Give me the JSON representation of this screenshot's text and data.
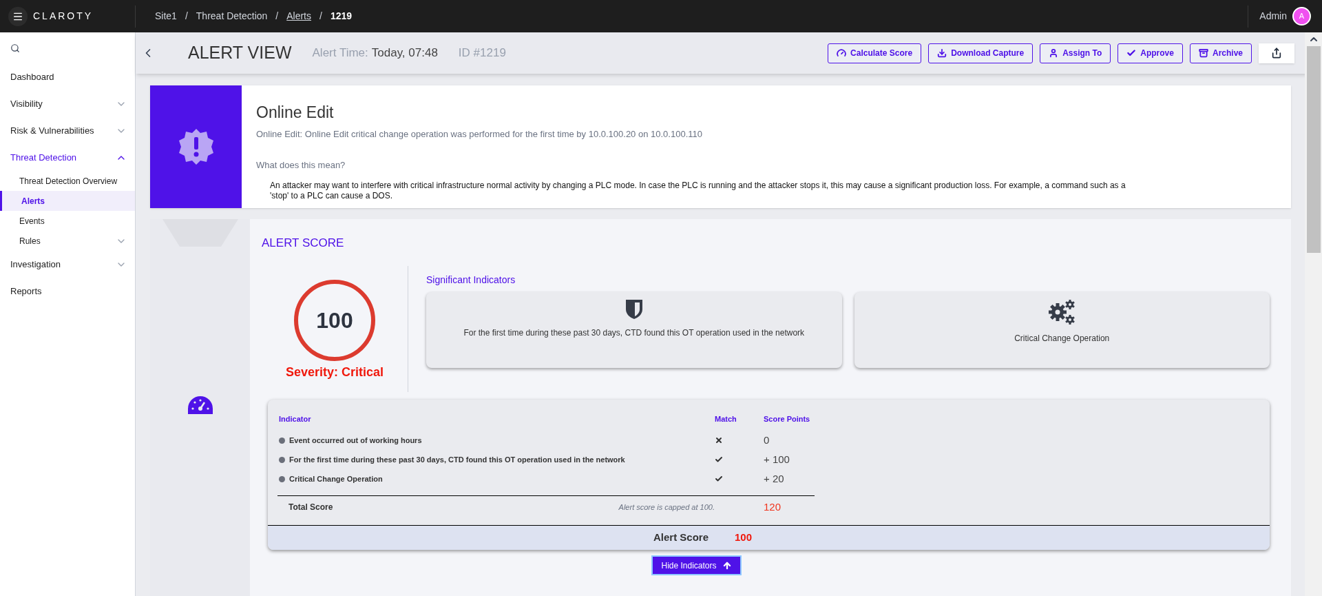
{
  "topbar": {
    "brand": "CLAROTY",
    "breadcrumbs": [
      {
        "label": "Site1",
        "kind": "text"
      },
      {
        "separator": "/",
        "label": "Threat Detection",
        "kind": "text"
      },
      {
        "separator": "/",
        "label": "Alerts",
        "kind": "link"
      },
      {
        "separator": "/",
        "label": "1219",
        "kind": "current"
      }
    ],
    "user": {
      "name": "Admin",
      "initial": "A"
    }
  },
  "sidebar": {
    "items": [
      {
        "label": "Dashboard",
        "kind": "link",
        "selected": false
      },
      {
        "label": "Visibility",
        "kind": "group",
        "selected": false,
        "expanded": false
      },
      {
        "label": "Risk & Vulnerabilities",
        "kind": "group",
        "selected": false,
        "expanded": false
      },
      {
        "label": "Threat Detection",
        "kind": "group",
        "selected": true,
        "expanded": true,
        "children": [
          {
            "label": "Threat Detection Overview",
            "kind": "link",
            "selected": false
          },
          {
            "label": "Alerts",
            "kind": "link",
            "selected": true
          },
          {
            "label": "Events",
            "kind": "link",
            "selected": false
          },
          {
            "label": "Rules",
            "kind": "group",
            "selected": false,
            "expanded": false
          }
        ]
      },
      {
        "label": "Investigation",
        "kind": "group",
        "selected": false,
        "expanded": false
      },
      {
        "label": "Reports",
        "kind": "link",
        "selected": false
      }
    ]
  },
  "header": {
    "title": "ALERT VIEW",
    "time_label": "Alert Time:",
    "time": "Today, 07:48",
    "id": "ID #1219",
    "buttons": [
      {
        "label": "Calculate Score",
        "kind": "gauge"
      },
      {
        "label": "Download Capture",
        "kind": "download"
      },
      {
        "label": "Assign To",
        "kind": "user"
      },
      {
        "label": "Approve",
        "kind": "check"
      },
      {
        "label": "Archive",
        "kind": "archive"
      }
    ]
  },
  "alert": {
    "title": "Online Edit",
    "description": "Online Edit: Online Edit critical change operation was performed for the first time by 10.0.100.20 on 10.0.100.110",
    "question": "What does this mean?",
    "explanation": "An attacker may want to interfere with critical infrastructure normal activity by changing a PLC mode. In case the PLC is running and the attacker stops it, this may cause a significant production loss. For example, a command such as a 'stop' to a PLC can cause a DOS."
  },
  "score": {
    "title": "ALERT SCORE",
    "value": "100",
    "severity": "Severity: Critical",
    "indicators_title": "Significant Indicators",
    "indicators": [
      {
        "text": "For the first time during these past 30 days, CTD found this OT operation used in the network",
        "kind": "shield"
      },
      {
        "text": "Critical Change Operation",
        "kind": "gears"
      }
    ],
    "table": {
      "columns": [
        "Indicator",
        "Match",
        "Score Points"
      ],
      "rows": [
        {
          "indicator": "Event occurred out of working hours",
          "matched": false,
          "points": "0"
        },
        {
          "indicator": "For the first time during these past 30 days, CTD found this OT operation used in the network",
          "matched": true,
          "points": "+ 100"
        },
        {
          "indicator": "Critical Change Operation",
          "matched": true,
          "points": "+ 20"
        }
      ],
      "total_label": "Total Score",
      "cap_note": "Alert score is capped at 100.",
      "total": "120",
      "alert_score_label": "Alert Score",
      "alert_score": "100"
    },
    "hide_button": "Hide Indicators"
  }
}
